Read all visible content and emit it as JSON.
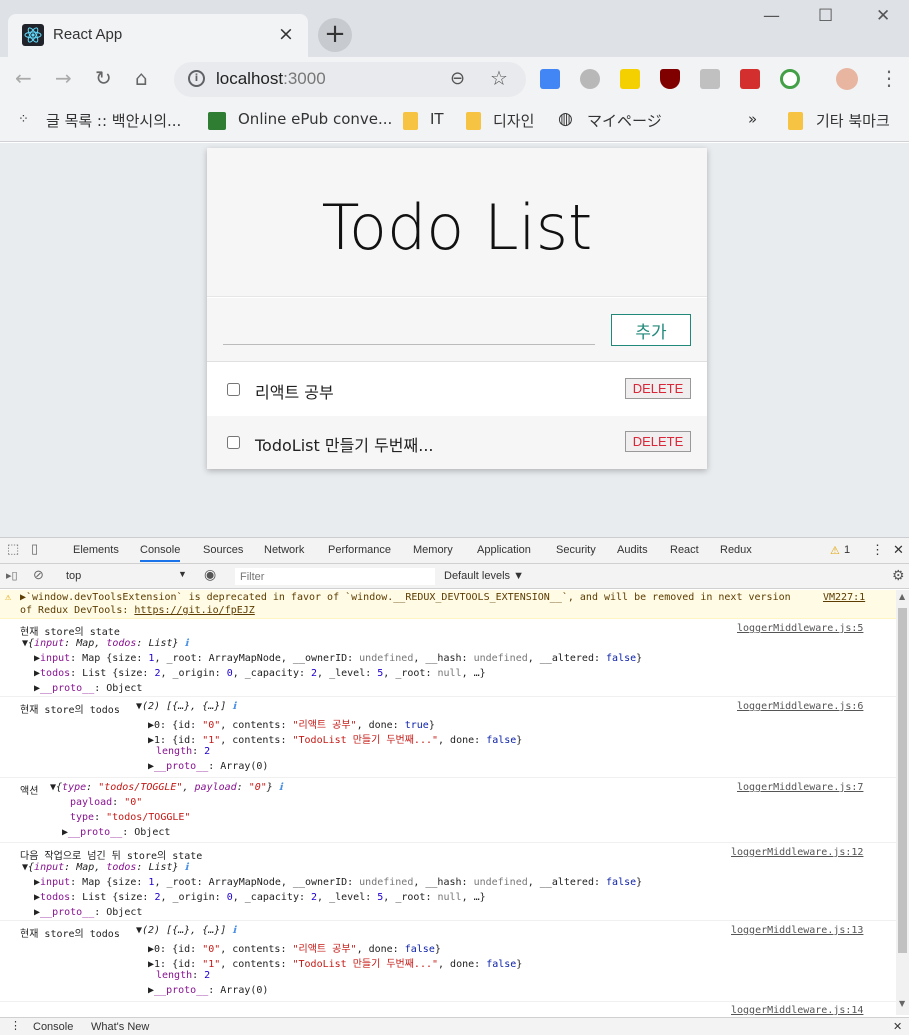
{
  "browser": {
    "tab_title": "React App",
    "tab_close": "×",
    "new_tab": "+",
    "win_minimize": "—",
    "win_maximize": "☐",
    "win_close": "✕",
    "url_host": "localhost",
    "url_port": ":3000",
    "bookmarks": [
      {
        "label": "글 목록 :: 백안시의..."
      },
      {
        "label": "Online ePub conve..."
      },
      {
        "label": "IT"
      },
      {
        "label": "디자인"
      },
      {
        "label": "マイページ"
      }
    ],
    "bookmarks_more": "»",
    "other_bookmarks": "기타 북마크"
  },
  "app": {
    "title": "Todo List",
    "add_button": "추가",
    "input_value": "",
    "todos": [
      {
        "text": "리액트 공부",
        "done": false,
        "delete_label": "DELETE"
      },
      {
        "text": "TodoList 만들기 두번째...",
        "done": false,
        "delete_label": "DELETE"
      }
    ]
  },
  "devtools": {
    "tabs": [
      "Elements",
      "Console",
      "Sources",
      "Network",
      "Performance",
      "Memory",
      "Application",
      "Security",
      "Audits",
      "React",
      "Redux"
    ],
    "active_tab": "Console",
    "warning_count": "1",
    "context": "top",
    "filter_placeholder": "Filter",
    "levels": "Default levels ▼",
    "drawer_tabs": [
      "Console",
      "What's New"
    ],
    "messages": {
      "warn1": "▶`window.devToolsExtension` is deprecated in favor of `window.__REDUX_DEVTOOLS_EXTENSION__`, and will be removed in next version",
      "warn_link": "VM227:1",
      "warn2_prefix": "of Redux DevTools: ",
      "warn2_link": "https://git.io/fpEJZ",
      "m1_label": "현재 store의 state",
      "m1_link": "loggerMiddleware.js:5",
      "m2_label": "현재 store의 todos",
      "m2_link": "loggerMiddleware.js:6",
      "m3_label": "액션",
      "m3_link": "loggerMiddleware.js:7",
      "m4_label": "다음 작업으로 넘긴 뒤 store의 state",
      "m4_link": "loggerMiddleware.js:12",
      "m5_label": "현재 store의 todos",
      "m5_link": "loggerMiddleware.js:13",
      "m6_link": "loggerMiddleware.js:14"
    }
  }
}
